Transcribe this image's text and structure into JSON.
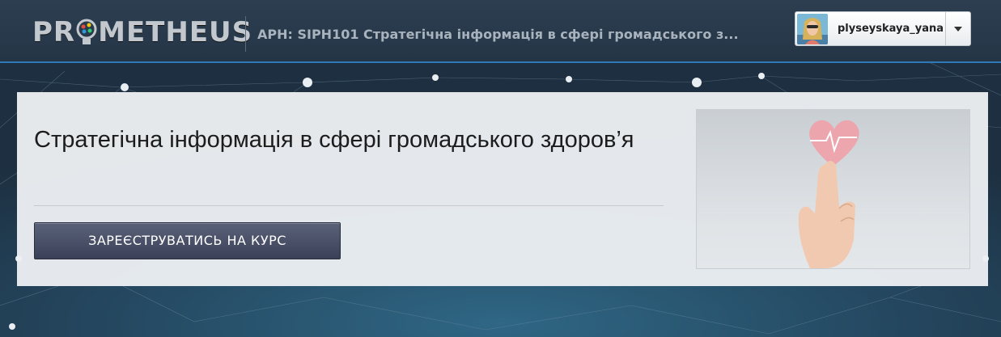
{
  "header": {
    "logo_text": "PROMETHEUS",
    "course_breadcrumb": "APH: SIPH101 Стратегічна інформація в сфері громадського з...",
    "user": {
      "username": "plyseyskaya_yana",
      "avatar_icon": "user-avatar",
      "menu_icon": "caret-down-icon"
    }
  },
  "course": {
    "title": "Стратегічна інформація в сфері громадського здоров’я",
    "enroll_label": "ЗАРЕЄСТРУВАТИСЬ НА КУРС",
    "image_alt": "heart-hand-illustration"
  },
  "colors": {
    "header_bg": "#2c3e50",
    "header_accent": "#2f79b8",
    "button_bg": "#474e66",
    "card_bg": "#eceff2"
  }
}
